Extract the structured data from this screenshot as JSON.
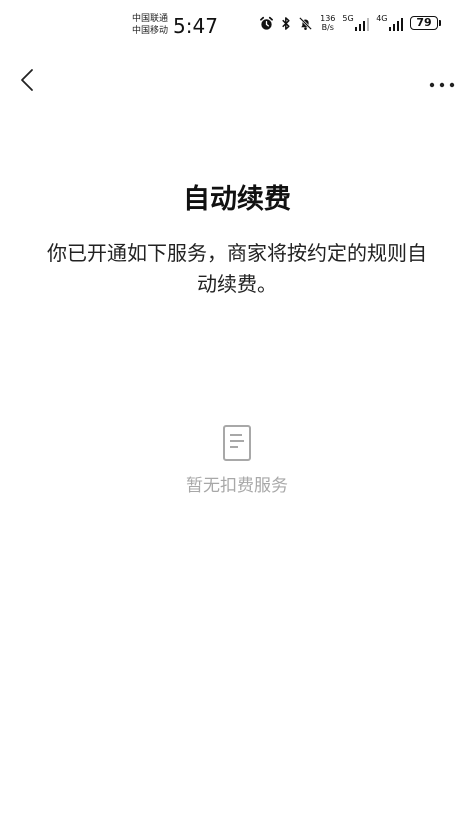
{
  "status_bar": {
    "carrier_1": "中国联通",
    "carrier_2": "中国移动",
    "time": "5:47",
    "net_speed_value": "136",
    "net_speed_unit": "B/s",
    "sim1_network": "5G",
    "sim2_network": "4G",
    "battery": "79"
  },
  "page": {
    "title": "自动续费",
    "description": "你已开通如下服务，商家将按约定的规则自动续费。"
  },
  "empty_state": {
    "icon": "document-icon",
    "text": "暂无扣费服务"
  },
  "colors": {
    "background": "#ffffff",
    "primary_text": "#111111",
    "muted_text": "#a8a8a8"
  }
}
